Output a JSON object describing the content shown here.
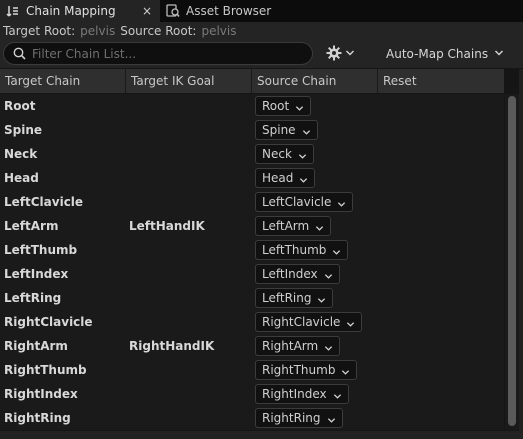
{
  "tabs": [
    {
      "label": "Chain Mapping",
      "icon": "chain-mapping-icon",
      "active": true,
      "close": "×"
    },
    {
      "label": "Asset Browser",
      "icon": "asset-browser-icon",
      "active": false
    }
  ],
  "roots": {
    "target_label": "Target Root:",
    "target_value": "pelvis",
    "source_label": "Source Root:",
    "source_value": "pelvis"
  },
  "toolbar": {
    "search_placeholder": "Filter Chain List...",
    "search_value": "",
    "settings_icon": "gear-icon",
    "auto_map_label": "Auto-Map Chains"
  },
  "columns": [
    "Target Chain",
    "Target IK Goal",
    "Source Chain",
    "Reset"
  ],
  "rows": [
    {
      "target": "Root",
      "ik_goal": "",
      "source": "Root"
    },
    {
      "target": "Spine",
      "ik_goal": "",
      "source": "Spine"
    },
    {
      "target": "Neck",
      "ik_goal": "",
      "source": "Neck"
    },
    {
      "target": "Head",
      "ik_goal": "",
      "source": "Head"
    },
    {
      "target": "LeftClavicle",
      "ik_goal": "",
      "source": "LeftClavicle"
    },
    {
      "target": "LeftArm",
      "ik_goal": "LeftHandIK",
      "source": "LeftArm"
    },
    {
      "target": "LeftThumb",
      "ik_goal": "",
      "source": "LeftThumb"
    },
    {
      "target": "LeftIndex",
      "ik_goal": "",
      "source": "LeftIndex"
    },
    {
      "target": "LeftRing",
      "ik_goal": "",
      "source": "LeftRing"
    },
    {
      "target": "RightClavicle",
      "ik_goal": "",
      "source": "RightClavicle"
    },
    {
      "target": "RightArm",
      "ik_goal": "RightHandIK",
      "source": "RightArm"
    },
    {
      "target": "RightThumb",
      "ik_goal": "",
      "source": "RightThumb"
    },
    {
      "target": "RightIndex",
      "ik_goal": "",
      "source": "RightIndex"
    },
    {
      "target": "RightRing",
      "ik_goal": "",
      "source": "RightRing"
    }
  ],
  "colors": {
    "background": "#151515",
    "panel": "#242424",
    "header": "#2f2f2f",
    "text_bright": "#d8d8d8",
    "text_dim": "#7a7a7a"
  }
}
